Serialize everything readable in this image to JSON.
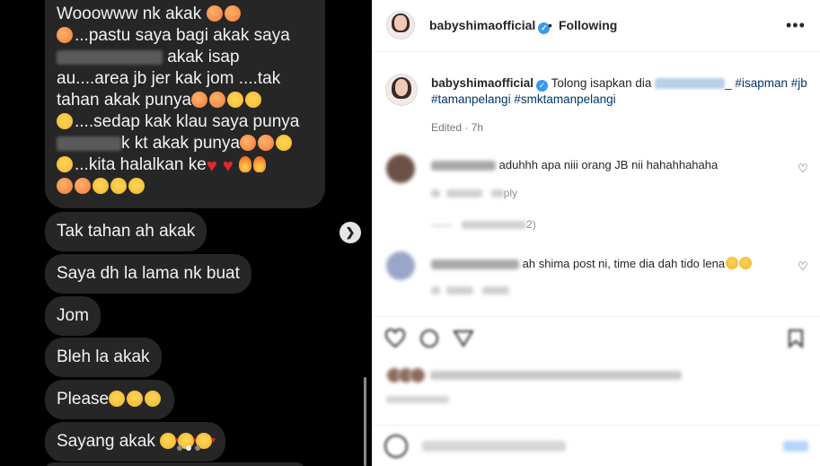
{
  "chat": {
    "message1": {
      "line1": "Wooowww nk akak",
      "line2": "...pastu saya bagi akak saya",
      "line3": "akak isap",
      "line4": "au....area jb jer kak jom ....tak",
      "line5": "tahan akak punya",
      "line6": "....sedap kak klau saya punya",
      "line7": "k kt akak punya",
      "line8": "...kita halalkan ke"
    },
    "message2": "Tak tahan ah akak",
    "message3": "Saya dh la lama nk buat",
    "message4": "Jom",
    "message5": "Bleh la akak",
    "message6": "Please",
    "message7": "Sayang akak"
  },
  "post": {
    "header": {
      "username": "babyshimaofficial",
      "separator": "•",
      "follow_status": "Following",
      "more_icon": "more-horizontal-icon"
    },
    "caption": {
      "username": "babyshimaofficial",
      "text": "Tolong isapkan dia",
      "tags": [
        "_ #isapman",
        "#jb",
        "#tamanpelangi",
        "#smktamanpelangi"
      ]
    },
    "edited": "Edited · 7h",
    "comments": [
      {
        "text": "aduhhh apa niii orang JB nii hahahhahaha",
        "reply_label": "ply"
      },
      {
        "text": "ah shima post ni, time dia dah tido lena",
        "reply_label": "Reply"
      }
    ],
    "view_replies_suffix": "2)"
  },
  "colors": {
    "chat_bg": "#000000",
    "bubble_bg": "#262626",
    "hashtag": "#00376b",
    "verified": "#3897f0"
  }
}
